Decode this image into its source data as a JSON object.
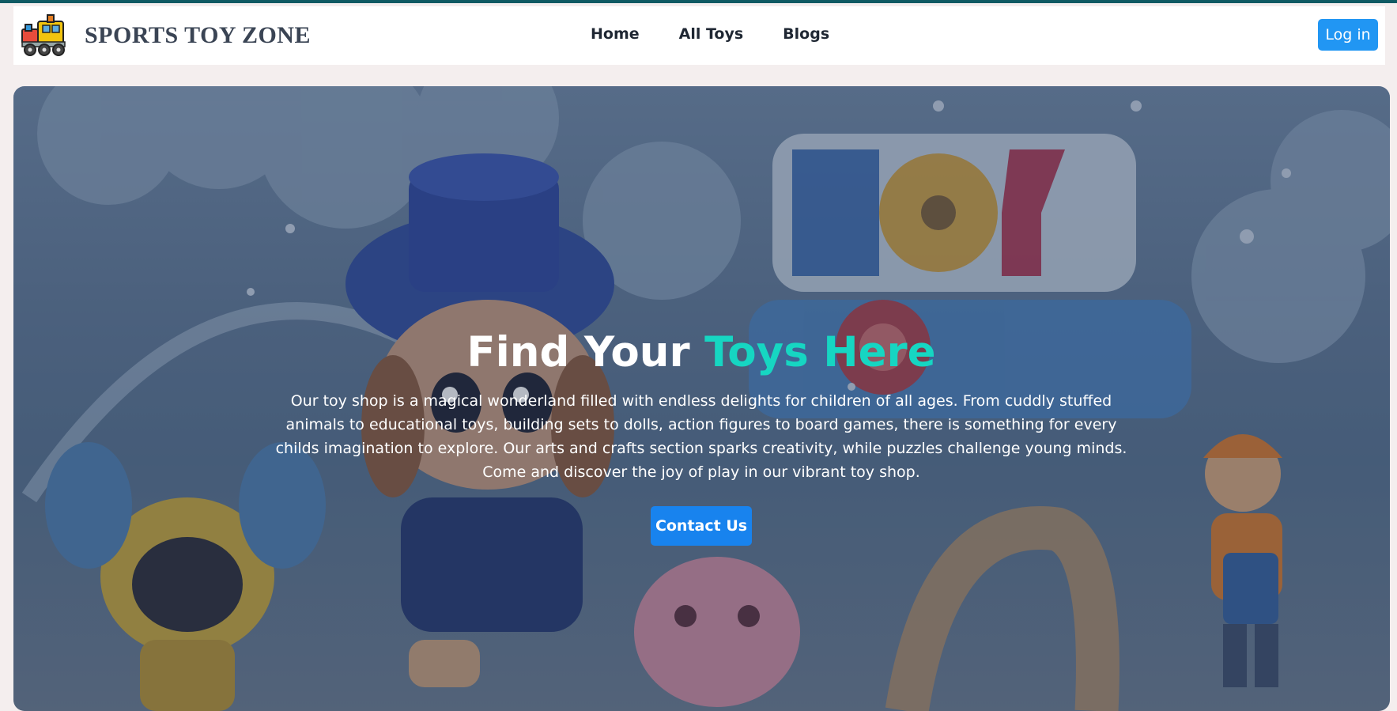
{
  "header": {
    "brand": "SPORTS TOY ZONE",
    "logo_icon": "toy-train-icon",
    "nav": [
      {
        "label": "Home"
      },
      {
        "label": "All Toys"
      },
      {
        "label": "Blogs"
      }
    ],
    "login_label": "Log in"
  },
  "hero": {
    "title_main": "Find Your",
    "title_accent": "Toys Here",
    "description": "Our toy shop is a magical wonderland filled with endless delights for children of all ages. From cuddly stuffed animals to educational toys, building sets to dolls, action figures to board games, there is something for every childs imagination to explore. Our arts and crafts section sparks creativity, while puzzles challenge young minds. Come and discover the joy of play in our vibrant toy shop.",
    "cta_label": "Contact Us"
  },
  "colors": {
    "top_strip": "#0f5a63",
    "brand_text": "#3a4454",
    "login_button": "#2196f3",
    "accent_text": "#16d6c2",
    "cta_button": "#1883ee",
    "page_background": "#f4eeee"
  }
}
